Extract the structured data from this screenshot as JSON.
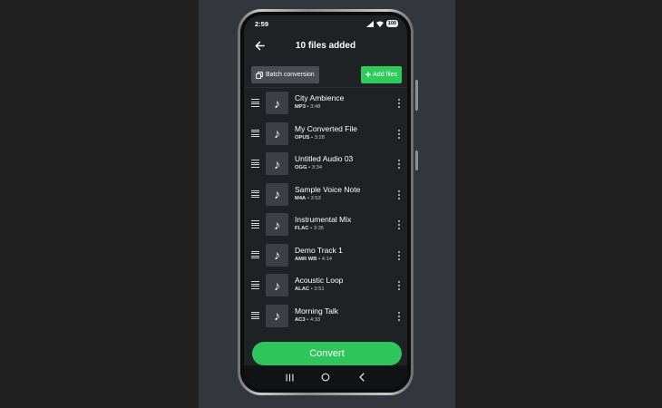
{
  "status_bar": {
    "time": "2:59",
    "battery": "100"
  },
  "app_bar": {
    "back_icon": "arrow-left-icon",
    "title": "10 files added"
  },
  "toolbar": {
    "batch_label": "Batch conversion",
    "add_label": "Add files"
  },
  "files": [
    {
      "name": "City Ambience",
      "format": "MP3",
      "duration": "3:48"
    },
    {
      "name": "My Converted File",
      "format": "OPUS",
      "duration": "3:28"
    },
    {
      "name": "Untitled Audio 03",
      "format": "OGG",
      "duration": "3:34"
    },
    {
      "name": "Sample Voice Note",
      "format": "M4A",
      "duration": "3:53"
    },
    {
      "name": "Instrumental Mix",
      "format": "FLAC",
      "duration": "3:35"
    },
    {
      "name": "Demo Track 1",
      "format": "AMR WB",
      "duration": "4:14"
    },
    {
      "name": "Acoustic Loop",
      "format": "ALAC",
      "duration": "3:51"
    },
    {
      "name": "Morning Talk",
      "format": "AC3",
      "duration": "4:33"
    }
  ],
  "meta_separator": " • ",
  "convert_label": "Convert",
  "colors": {
    "accent": "#2ecc5a",
    "screen_bg": "#1f2225",
    "thumb_bg": "#3c4045"
  },
  "icons": {
    "music": "music-note-icon",
    "drag": "drag-handle-icon",
    "menu": "more-vert-icon"
  }
}
